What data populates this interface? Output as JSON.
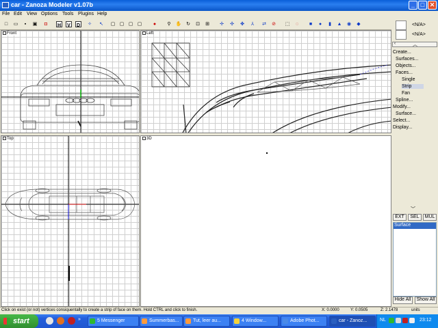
{
  "window": {
    "title": "car - Zanoza Modeler v1.07b",
    "minimize": "_",
    "maximize": "□",
    "close": "✕"
  },
  "menu": [
    "File",
    "Edit",
    "View",
    "Options",
    "Tools",
    "Plugins",
    "Help"
  ],
  "toolbar": {
    "h_label": "H",
    "v_label": "V",
    "d_label": "D"
  },
  "viewports": {
    "front": "Front",
    "left": "Left",
    "top": "Top",
    "perspective": "3D"
  },
  "panel": {
    "spinner1_value": "<N/A>",
    "spinner2_value": "<N/A>",
    "menu": {
      "create": "Create...",
      "surfaces": "Surfaces...",
      "objects": "Objects...",
      "faces": "Faces...",
      "single": "Single",
      "strip": "Strip",
      "fan": "Fan",
      "spline": "Spline...",
      "modify": "Modify...",
      "surface": "Surface...",
      "select": "Select...",
      "display": "Display..."
    },
    "ext": "EXT",
    "sel": "SEL",
    "mul": "MUL",
    "list": [
      "Surface"
    ],
    "hide_all": "Hide All",
    "show_all": "Show All"
  },
  "status": {
    "hint": "Click on exist (or not) vertices consiquentally to create a strip of face on them. Hold CTRL and click to finish.",
    "x": "X: 0.0000",
    "y": "Y: 0.0505",
    "z": "Z: 2.1478",
    "units": "units"
  },
  "taskbar": {
    "start": "start",
    "tasks": [
      "5 Messenger",
      "Summerbas...",
      "Tut, leer au...",
      "4 Window...",
      "Adobe Phot...",
      "car - Zanoz..."
    ],
    "lang": "NL",
    "clock": "23:12"
  },
  "colors": {
    "title_bar": "#0a5fd8",
    "selection": "#316ac5",
    "taskbar": "#245edb",
    "start": "#2f8f2f"
  }
}
